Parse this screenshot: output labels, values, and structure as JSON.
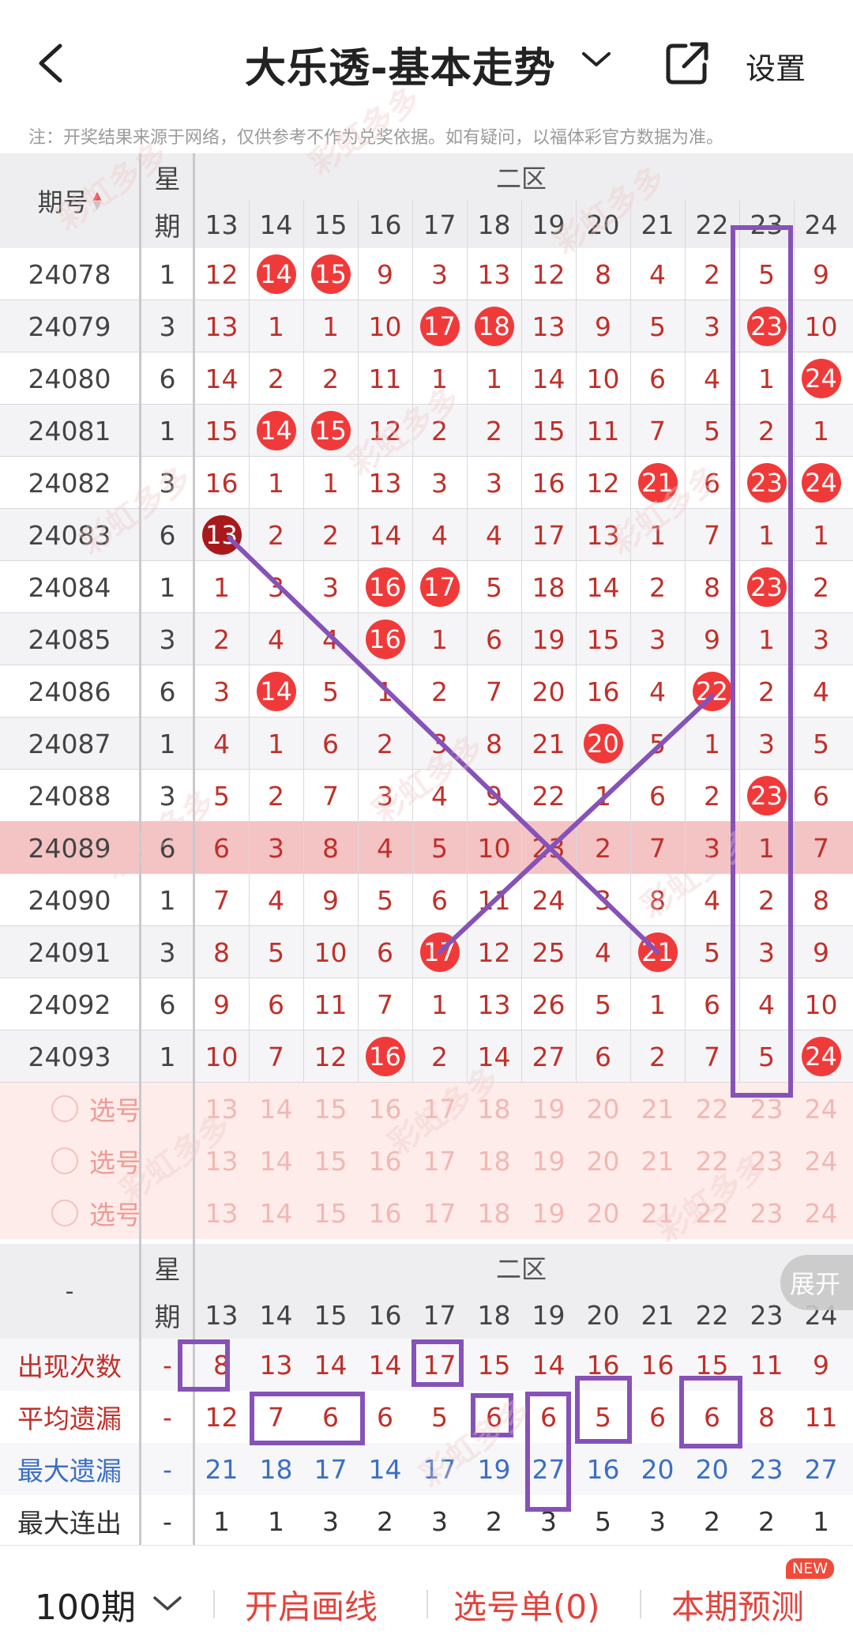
{
  "header": {
    "title": "大乐透-基本走势",
    "settings_label": "设置",
    "notice": "注：开奖结果来源于网络，仅供参考不作为兑奖依据。如有疑问，以福体彩官方数据为准。"
  },
  "table": {
    "col_issue_label": "期号",
    "col_week_label": [
      "星",
      "期"
    ],
    "zone_label": "二区",
    "columns": [
      "13",
      "14",
      "15",
      "16",
      "17",
      "18",
      "19",
      "20",
      "21",
      "22",
      "23",
      "24"
    ],
    "rows": [
      {
        "issue": "24078",
        "week": "1",
        "vals": [
          "12",
          "14",
          "15",
          "9",
          "3",
          "13",
          "12",
          "8",
          "4",
          "2",
          "5",
          "9"
        ],
        "hits": [
          1,
          2
        ]
      },
      {
        "issue": "24079",
        "week": "3",
        "vals": [
          "13",
          "1",
          "1",
          "10",
          "17",
          "18",
          "13",
          "9",
          "5",
          "3",
          "23",
          "10"
        ],
        "hits": [
          4,
          5,
          10
        ]
      },
      {
        "issue": "24080",
        "week": "6",
        "vals": [
          "14",
          "2",
          "2",
          "11",
          "1",
          "1",
          "14",
          "10",
          "6",
          "4",
          "1",
          "24"
        ],
        "hits": [
          11
        ]
      },
      {
        "issue": "24081",
        "week": "1",
        "vals": [
          "15",
          "14",
          "15",
          "12",
          "2",
          "2",
          "15",
          "11",
          "7",
          "5",
          "2",
          "1"
        ],
        "hits": [
          1,
          2
        ]
      },
      {
        "issue": "24082",
        "week": "3",
        "vals": [
          "16",
          "1",
          "1",
          "13",
          "3",
          "3",
          "16",
          "12",
          "21",
          "6",
          "23",
          "24"
        ],
        "hits": [
          8,
          10,
          11
        ]
      },
      {
        "issue": "24083",
        "week": "6",
        "vals": [
          "13",
          "2",
          "2",
          "14",
          "4",
          "4",
          "17",
          "13",
          "1",
          "7",
          "1",
          "1"
        ],
        "hits": [
          0
        ],
        "dark": [
          0
        ]
      },
      {
        "issue": "24084",
        "week": "1",
        "vals": [
          "1",
          "3",
          "3",
          "16",
          "17",
          "5",
          "18",
          "14",
          "2",
          "8",
          "23",
          "2"
        ],
        "hits": [
          3,
          4,
          10
        ]
      },
      {
        "issue": "24085",
        "week": "3",
        "vals": [
          "2",
          "4",
          "4",
          "16",
          "1",
          "6",
          "19",
          "15",
          "3",
          "9",
          "1",
          "3"
        ],
        "hits": [
          3
        ]
      },
      {
        "issue": "24086",
        "week": "6",
        "vals": [
          "3",
          "14",
          "5",
          "1",
          "2",
          "7",
          "20",
          "16",
          "4",
          "22",
          "2",
          "4"
        ],
        "hits": [
          1,
          9
        ]
      },
      {
        "issue": "24087",
        "week": "1",
        "vals": [
          "4",
          "1",
          "6",
          "2",
          "3",
          "8",
          "21",
          "20",
          "5",
          "1",
          "3",
          "5"
        ],
        "hits": [
          7
        ]
      },
      {
        "issue": "24088",
        "week": "3",
        "vals": [
          "5",
          "2",
          "7",
          "3",
          "4",
          "9",
          "22",
          "1",
          "6",
          "2",
          "23",
          "6"
        ],
        "hits": [
          10
        ]
      },
      {
        "issue": "24089",
        "week": "6",
        "vals": [
          "6",
          "3",
          "8",
          "4",
          "5",
          "10",
          "23",
          "2",
          "7",
          "3",
          "1",
          "7"
        ],
        "hits": [],
        "highlight": true
      },
      {
        "issue": "24090",
        "week": "1",
        "vals": [
          "7",
          "4",
          "9",
          "5",
          "6",
          "11",
          "24",
          "3",
          "8",
          "4",
          "2",
          "8"
        ],
        "hits": []
      },
      {
        "issue": "24091",
        "week": "3",
        "vals": [
          "8",
          "5",
          "10",
          "6",
          "17",
          "12",
          "25",
          "4",
          "21",
          "5",
          "3",
          "9"
        ],
        "hits": [
          4,
          8
        ]
      },
      {
        "issue": "24092",
        "week": "6",
        "vals": [
          "9",
          "6",
          "11",
          "7",
          "1",
          "13",
          "26",
          "5",
          "1",
          "6",
          "4",
          "10"
        ],
        "hits": []
      },
      {
        "issue": "24093",
        "week": "1",
        "vals": [
          "10",
          "7",
          "12",
          "16",
          "2",
          "14",
          "27",
          "6",
          "2",
          "7",
          "5",
          "24"
        ],
        "hits": [
          3,
          11
        ]
      }
    ],
    "select_label": "选号",
    "select_rows": 3
  },
  "stats": {
    "left_header": "-",
    "rows": [
      {
        "label": "出现次数",
        "dash": "-",
        "vals": [
          "8",
          "13",
          "14",
          "14",
          "17",
          "15",
          "14",
          "16",
          "16",
          "15",
          "11",
          "9"
        ],
        "color": "#c0302a"
      },
      {
        "label": "平均遗漏",
        "dash": "-",
        "vals": [
          "12",
          "7",
          "6",
          "6",
          "5",
          "6",
          "6",
          "5",
          "6",
          "6",
          "8",
          "11"
        ],
        "color": "#c0302a"
      },
      {
        "label": "最大遗漏",
        "dash": "-",
        "vals": [
          "21",
          "18",
          "17",
          "14",
          "17",
          "19",
          "27",
          "16",
          "20",
          "20",
          "23",
          "27"
        ],
        "color": "#3b6fc4"
      },
      {
        "label": "最大连出",
        "dash": "-",
        "vals": [
          "1",
          "1",
          "3",
          "2",
          "3",
          "2",
          "3",
          "5",
          "3",
          "2",
          "2",
          "1"
        ],
        "color": "#333333"
      }
    ]
  },
  "expand_label": "展开",
  "footer": {
    "period_label": "100期",
    "draw_line_label": "开启画线",
    "select_list_label": "选号单(0)",
    "predict_label": "本期预测",
    "new_badge": "NEW"
  },
  "watermark": "彩虹多多",
  "colors": {
    "accent": "#e2433c",
    "ball": "#f03a3a",
    "ball_dark": "#a8191b",
    "drawn_line": "#8652b8"
  }
}
